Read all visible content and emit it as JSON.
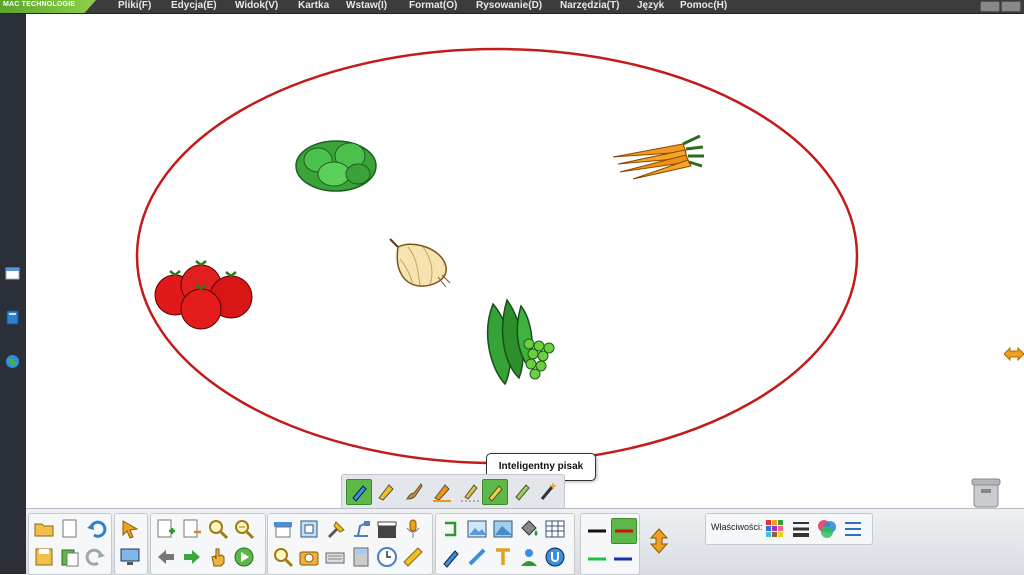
{
  "app": {
    "logo_text": "MAC TECHNOLOGIE"
  },
  "menu": [
    "Pliki(F)",
    "Edycja(E)",
    "Widok(V)",
    "Kartka",
    "Wstaw(I)",
    "Format(O)",
    "Rysowanie(D)",
    "Narzędzia(T)",
    "Język",
    "Pomoc(H)"
  ],
  "tooltip": "Inteligentny pisak",
  "properties_label": "Właściwości:",
  "colors": {
    "ellipse_stroke": "#c41a1a",
    "active_tool": "#5db84a",
    "menubar": "#3c3c3c",
    "sidebar": "#2b3038"
  },
  "canvas_items": [
    "lettuce-icon",
    "carrots-icon",
    "onion-icon",
    "tomatoes-icon",
    "peas-icon"
  ]
}
